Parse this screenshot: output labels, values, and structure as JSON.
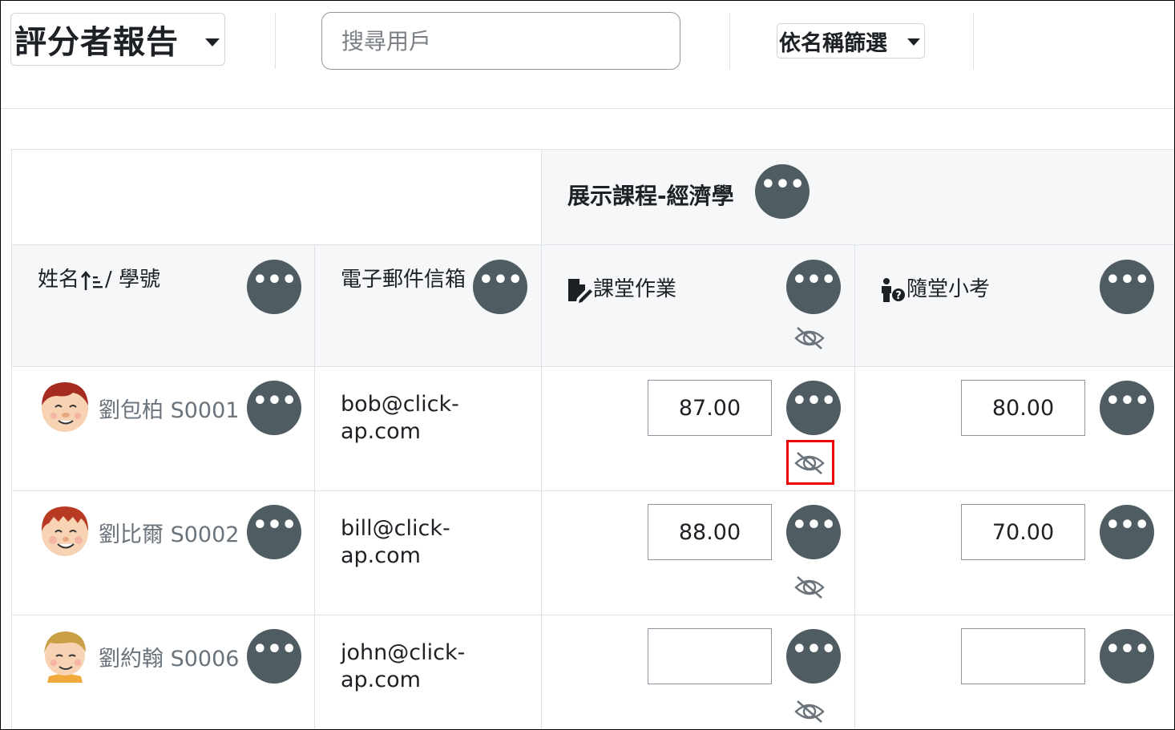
{
  "toolbar": {
    "report_select_label": "評分者報告",
    "search_placeholder": "搜尋用戶",
    "filter_label": "依名稱篩選"
  },
  "table": {
    "course_header": "展示課程-經濟學",
    "col_name": "姓名",
    "col_name_sep": "/ 學號",
    "col_email": "電子郵件信箱",
    "col_assignment": "課堂作業",
    "col_quiz": "隨堂小考",
    "rows": [
      {
        "name": "劉包柏 S0001",
        "email_line1": "bob@click-",
        "email_line2": "ap.com",
        "assignment": "87.00",
        "quiz": "80.00"
      },
      {
        "name": "劉比爾 S0002",
        "email_line1": "bill@click-",
        "email_line2": "ap.com",
        "assignment": "88.00",
        "quiz": "70.00"
      },
      {
        "name": "劉約翰 S0006",
        "email_line1": "john@click-",
        "email_line2": "ap.com",
        "assignment": "",
        "quiz": ""
      }
    ]
  },
  "icons": {
    "more": "three-dots-icon",
    "hidden": "eye-slash-icon",
    "assignment": "assignment-icon",
    "quiz": "quiz-icon",
    "sort": "sort-ascending-icon"
  },
  "colors": {
    "menu_button": "#4f5c62",
    "header_bg": "#f5f7f9",
    "highlight": "#ee0000",
    "muted_text": "#6a737b"
  }
}
